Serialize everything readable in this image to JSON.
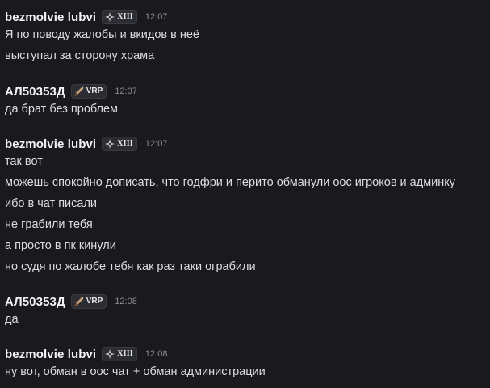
{
  "messages": [
    {
      "author": "bezmolvie lubvi",
      "tag_icon": "shuriken-icon",
      "tag_text": "XIII",
      "time": "12:07",
      "lines": [
        "Я по поводу жалобы и вкидов в неё",
        "выступал за сторону храма"
      ]
    },
    {
      "author": "АЛ50353Д",
      "tag_icon": "sword-icon",
      "tag_text": "VRP",
      "time": "12:07",
      "lines": [
        "да брат без проблем"
      ]
    },
    {
      "author": "bezmolvie lubvi",
      "tag_icon": "shuriken-icon",
      "tag_text": "XIII",
      "time": "12:07",
      "lines": [
        "так вот",
        "можешь спокойно дописать, что годфри и перито обманули оос игроков и админку",
        "ибо в чат писали",
        "не грабили тебя",
        "а просто в пк кинули",
        "но судя по жалобе тебя как раз таки ограбили"
      ]
    },
    {
      "author": "АЛ50353Д",
      "tag_icon": "sword-icon",
      "tag_text": "VRP",
      "time": "12:08",
      "lines": [
        "да"
      ]
    },
    {
      "author": "bezmolvie lubvi",
      "tag_icon": "shuriken-icon",
      "tag_text": "XIII",
      "time": "12:08",
      "lines": [
        "ну вот, обман в оос чат + обман администрации"
      ]
    }
  ],
  "colors": {
    "background": "#1a1a1e",
    "author": "#f2f3f5",
    "text": "#dbdee1",
    "timestamp": "#8b8e95",
    "tag_background": "#2c2d33",
    "sword_blade": "#c9a27a",
    "sword_hilt": "#7a5a3c"
  }
}
